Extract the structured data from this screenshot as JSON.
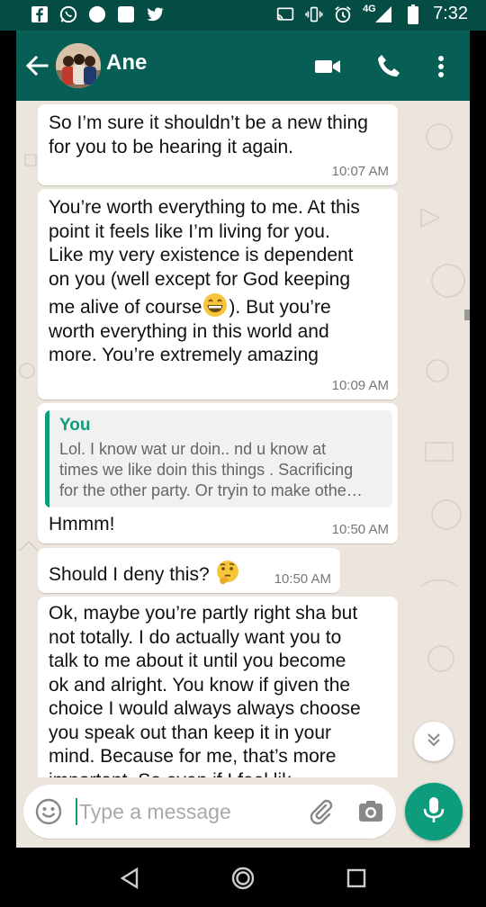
{
  "status_bar": {
    "time": "7:32",
    "network": "4G",
    "left_icons": [
      "facebook-icon",
      "whatsapp-icon",
      "circle-icon",
      "square-icon",
      "twitter-icon"
    ],
    "right_icons": [
      "cast-icon",
      "vibrate-icon",
      "alarm-icon",
      "signal-icon",
      "battery-icon"
    ]
  },
  "header": {
    "contact_name": "Ane",
    "icons": [
      "back-arrow-icon",
      "avatar",
      "video-call-icon",
      "phone-icon",
      "more-vert-icon"
    ]
  },
  "messages": [
    {
      "text": "So I’m sure it shouldn’t be a new thing\nfor you to be hearing it again.",
      "time": "10:07 AM"
    },
    {
      "text": "You’re worth everything to me. At this\npoint it feels like I’m living for you.\nLike my very existence is dependent\non you (well except for God keeping",
      "text_emoji_line_before": "me alive of course",
      "text_emoji_line_after": "). But you’re",
      "text_after": "worth everything in this world and\nmore. You’re extremely amazing",
      "emoji": "grinning-face-emoji",
      "time": "10:09 AM"
    },
    {
      "quote_author": "You",
      "quote_text": "Lol.  I know wat ur doin.. nd u know at\ntimes we like doin this things . Sacrificing\nfor the other party. Or tryin to make othe…",
      "text": "Hmmm!",
      "time": "10:50 AM"
    },
    {
      "text": "Should I deny this?",
      "emoji": "thinking-face-emoji",
      "time": "10:50 AM"
    },
    {
      "text": "Ok, maybe you’re partly right sha but\nnot totally. I do actually want you to\ntalk to me about it until you become\nok and alright. You know if given the\nchoice I would always always choose\nyou speak out than keep it in your\nmind. Because for me, that’s more\nimportant.  So even if I feel lik"
    }
  ],
  "composer": {
    "placeholder": "Type a message",
    "value": "",
    "icons": [
      "emoji-icon",
      "attach-icon",
      "camera-icon",
      "mic-icon"
    ]
  },
  "colors": {
    "status_bar": "#054d44",
    "app_bar": "#075e54",
    "accent": "#0d9d7d",
    "chat_bg": "#ece5dd",
    "bubble": "#ffffff"
  }
}
